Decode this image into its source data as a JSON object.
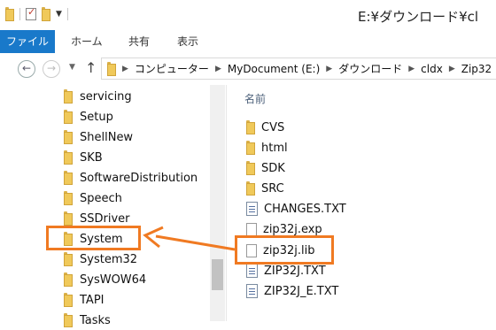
{
  "window": {
    "title": "E:¥ダウンロード¥cl"
  },
  "ribbon": {
    "tabs": [
      "ファイル",
      "ホーム",
      "共有",
      "表示"
    ]
  },
  "address": {
    "segments": [
      "コンピューター",
      "MyDocument (E:)",
      "ダウンロード",
      "cldx",
      "Zip32"
    ]
  },
  "nav_pane": {
    "items": [
      {
        "label": "servicing",
        "icon": "folder-icon"
      },
      {
        "label": "Setup",
        "icon": "folder-icon"
      },
      {
        "label": "ShellNew",
        "icon": "folder-icon"
      },
      {
        "label": "SKB",
        "icon": "folder-icon"
      },
      {
        "label": "SoftwareDistribution",
        "icon": "folder-icon"
      },
      {
        "label": "Speech",
        "icon": "folder-icon"
      },
      {
        "label": "SSDriver",
        "icon": "folder-icon"
      },
      {
        "label": "System",
        "icon": "folder-icon",
        "highlighted": true
      },
      {
        "label": "System32",
        "icon": "folder-icon"
      },
      {
        "label": "SysWOW64",
        "icon": "folder-icon"
      },
      {
        "label": "TAPI",
        "icon": "folder-icon"
      },
      {
        "label": "Tasks",
        "icon": "folder-icon"
      }
    ]
  },
  "file_pane": {
    "column_header": "名前",
    "items": [
      {
        "label": "CVS",
        "icon": "folder-icon"
      },
      {
        "label": "html",
        "icon": "folder-icon"
      },
      {
        "label": "SDK",
        "icon": "folder-icon"
      },
      {
        "label": "SRC",
        "icon": "folder-icon"
      },
      {
        "label": "CHANGES.TXT",
        "icon": "text-file-icon"
      },
      {
        "label": "zip32j.exp",
        "icon": "file-icon"
      },
      {
        "label": "zip32j.lib",
        "icon": "file-icon",
        "highlighted": true
      },
      {
        "label": "ZIP32J.TXT",
        "icon": "text-file-icon"
      },
      {
        "label": "ZIP32J_E.TXT",
        "icon": "text-file-icon"
      }
    ]
  },
  "annotation": {
    "color": "#f07a22",
    "meaning": "drag zip32j.lib to System folder"
  }
}
